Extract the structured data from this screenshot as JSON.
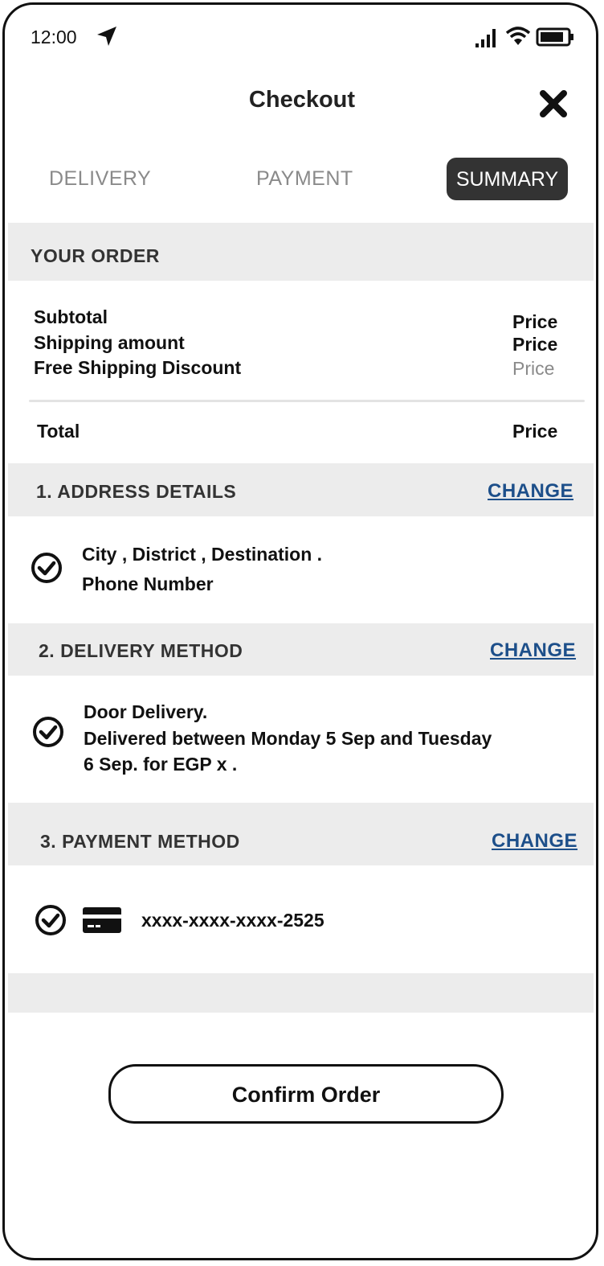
{
  "status_bar": {
    "time": "12:00"
  },
  "header": {
    "title": "Checkout"
  },
  "tabs": [
    {
      "label": "DELIVERY",
      "active": false
    },
    {
      "label": "PAYMENT",
      "active": false
    },
    {
      "label": "SUMMARY",
      "active": true
    }
  ],
  "order": {
    "heading": "YOUR ORDER",
    "lines": [
      {
        "label": "Subtotal",
        "value": "Price"
      },
      {
        "label": "Shipping amount",
        "value": "Price"
      },
      {
        "label": "Free Shipping Discount",
        "value": "Price"
      }
    ],
    "total": {
      "label": "Total",
      "value": "Price"
    }
  },
  "address": {
    "heading": "1. ADDRESS DETAILS",
    "change_label": "CHANGE",
    "line1": "City , District , Destination .",
    "line2": "Phone Number"
  },
  "delivery": {
    "heading": "2. DELIVERY METHOD",
    "change_label": "CHANGE",
    "line1": "Door Delivery.",
    "line2": "Delivered between Monday 5 Sep and Tuesday",
    "line3": "6 Sep. for EGP x ."
  },
  "payment": {
    "heading": "3. PAYMENT METHOD",
    "change_label": "CHANGE",
    "card_number": "xxxx-xxxx-xxxx-2525"
  },
  "actions": {
    "confirm_label": "Confirm Order"
  },
  "colors": {
    "link": "#1d4f8a",
    "band": "#ececec",
    "active_tab": "#333333",
    "muted": "#8a8a8a"
  },
  "icons": [
    "location-arrow-icon",
    "signal-icon",
    "wifi-icon",
    "battery-icon",
    "close-icon",
    "check-circle-icon",
    "credit-card-icon"
  ]
}
